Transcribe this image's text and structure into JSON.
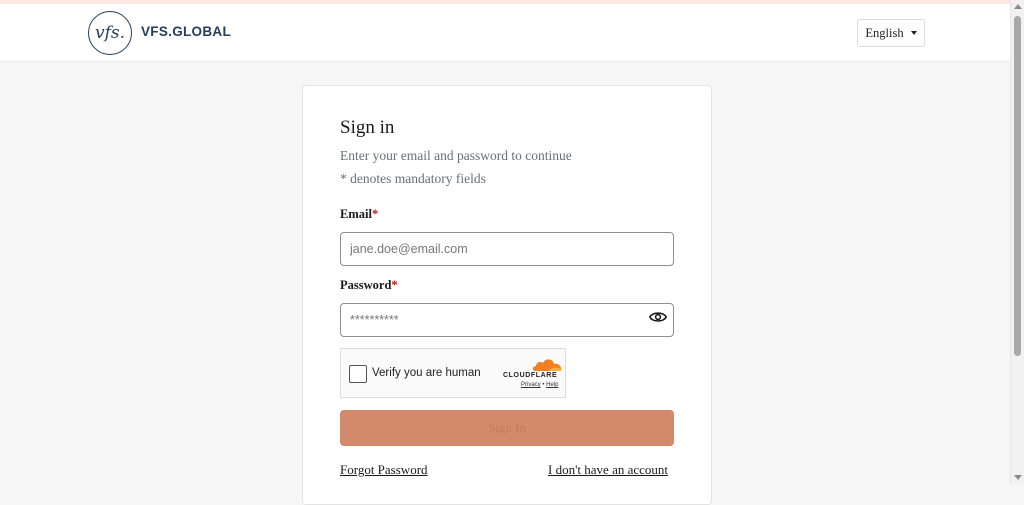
{
  "header": {
    "logo_mark": "vfs.",
    "logo_text": "VFS.GLOBAL",
    "language": "English"
  },
  "form": {
    "title": "Sign in",
    "subtitle": "Enter your email and password to continue",
    "mandatory_note": "* denotes mandatory fields",
    "email": {
      "label": "Email",
      "required_mark": "*",
      "placeholder": "jane.doe@email.com",
      "value": ""
    },
    "password": {
      "label": "Password",
      "required_mark": "*",
      "placeholder": "**********",
      "value": ""
    },
    "captcha": {
      "label": "Verify you are human",
      "brand": "CLOUDFLARE",
      "privacy": "Privacy",
      "separator": "•",
      "help": "Help",
      "checked": false
    },
    "submit_label": "Sign In",
    "forgot_password": "Forgot Password",
    "no_account": "I don't have an account"
  },
  "colors": {
    "brand_navy": "#243e5c",
    "button_disabled": "#d28a6a",
    "required": "#b31b1b",
    "cloudflare_orange": "#f38020"
  }
}
